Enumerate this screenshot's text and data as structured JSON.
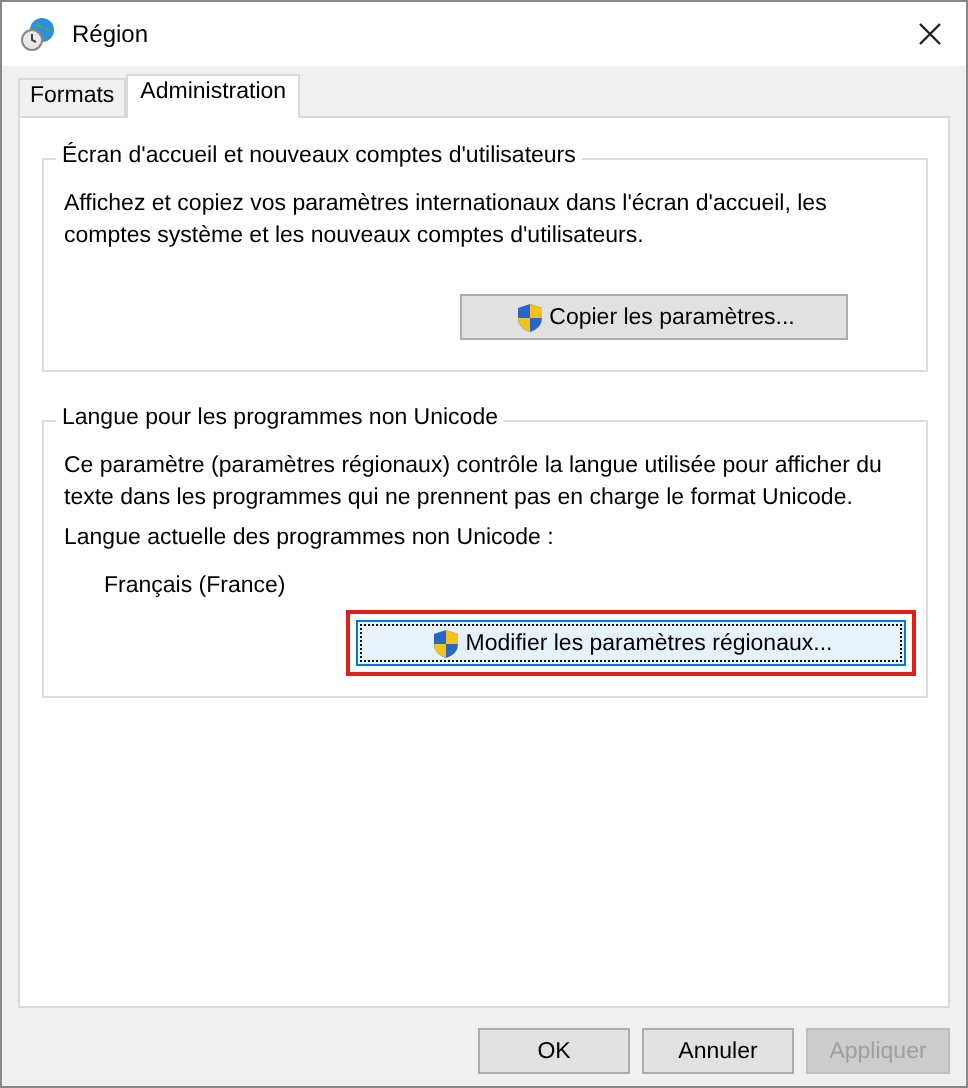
{
  "window": {
    "title": "Région"
  },
  "tabs": [
    {
      "label": "Formats",
      "selected": false
    },
    {
      "label": "Administration",
      "selected": true
    }
  ],
  "groups": [
    {
      "title": "Écran d'accueil et nouveaux comptes d'utilisateurs",
      "paragraphs": [
        "Affichez et copiez vos paramètres internationaux dans l'écran d'accueil, les comptes système et les nouveaux comptes d'utilisateurs."
      ],
      "button": {
        "label": "Copier les paramètres...",
        "highlighted": false
      }
    },
    {
      "title": "Langue pour les programmes non Unicode",
      "paragraphs": [
        "Ce paramètre (paramètres régionaux) contrôle la langue utilisée pour afficher du texte dans les programmes qui ne prennent pas en charge le format Unicode.",
        "Langue actuelle des programmes non Unicode :"
      ],
      "value": "Français (France)",
      "button": {
        "label": "Modifier les paramètres régionaux...",
        "highlighted": true
      }
    }
  ],
  "buttons": [
    {
      "label": "OK",
      "disabled": false
    },
    {
      "label": "Annuler",
      "disabled": false
    },
    {
      "label": "Appliquer",
      "disabled": true
    }
  ]
}
